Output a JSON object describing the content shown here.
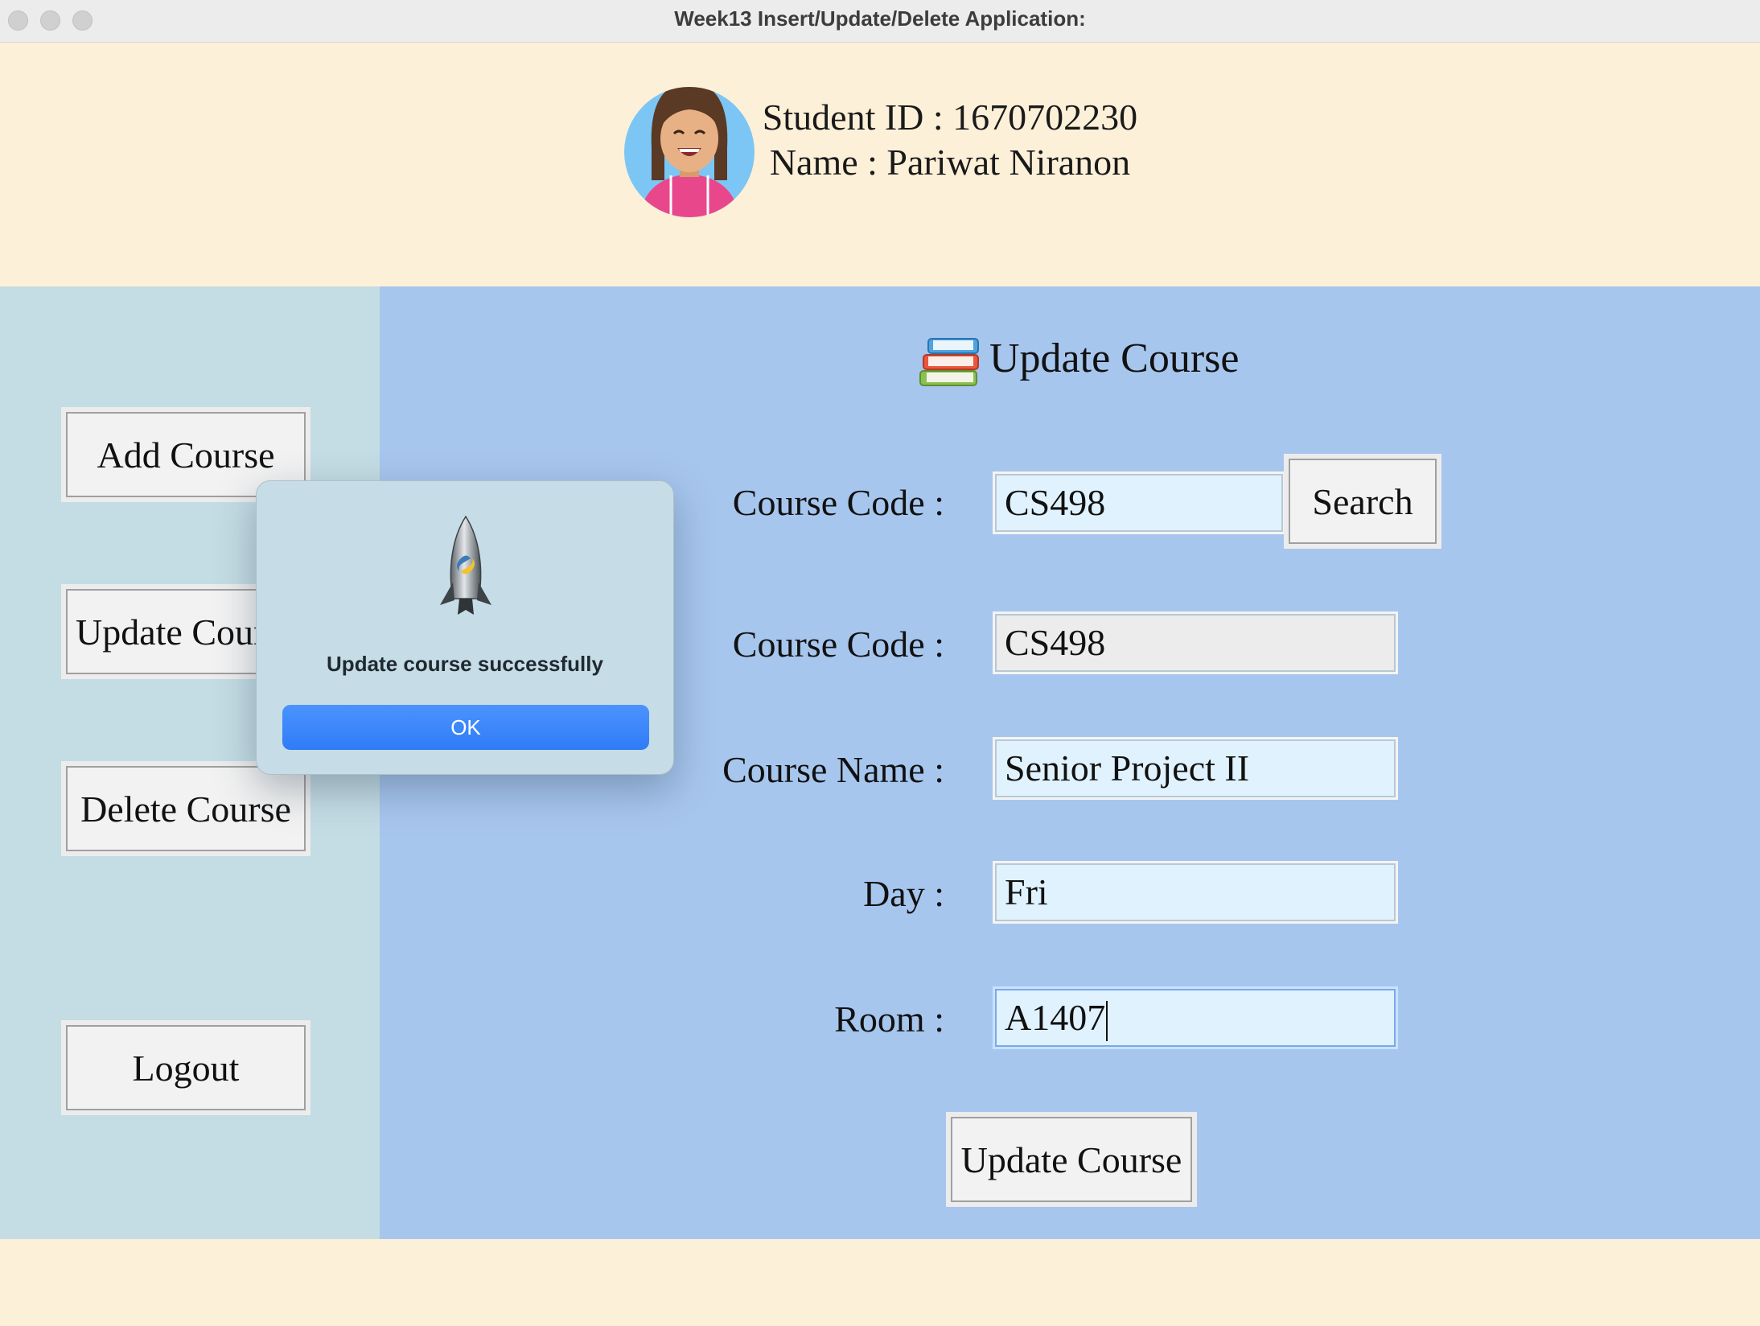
{
  "window": {
    "title": "Week13 Insert/Update/Delete Application:"
  },
  "header": {
    "student_id_line": "Student ID : 1670702230",
    "name_line": "Name : Pariwat Niranon"
  },
  "sidebar": {
    "add_course": "Add Course",
    "update_course": "Update Course",
    "delete_course": "Delete Course",
    "logout": "Logout"
  },
  "main": {
    "heading": "Update Course",
    "search_label": "Course Code :",
    "search_value": "CS498",
    "search_button": "Search",
    "code_label": "Course Code :",
    "code_value": "CS498",
    "name_label": "Course Name :",
    "name_value": "Senior Project II",
    "day_label": "Day :",
    "day_value": "Fri",
    "room_label": "Room :",
    "room_value": "A1407",
    "update_button": "Update Course"
  },
  "dialog": {
    "message": "Update course successfully",
    "ok": "OK"
  },
  "colors": {
    "header_bg": "#fdf0d8",
    "sidebar_bg": "#c4dce4",
    "main_bg": "#a7c6ee",
    "field_bg": "#e0f2fd",
    "dialog_ok": "#3a86fa"
  },
  "icons": {
    "avatar": "student-avatar",
    "heading": "books-icon",
    "dialog": "python-rocket-icon"
  }
}
